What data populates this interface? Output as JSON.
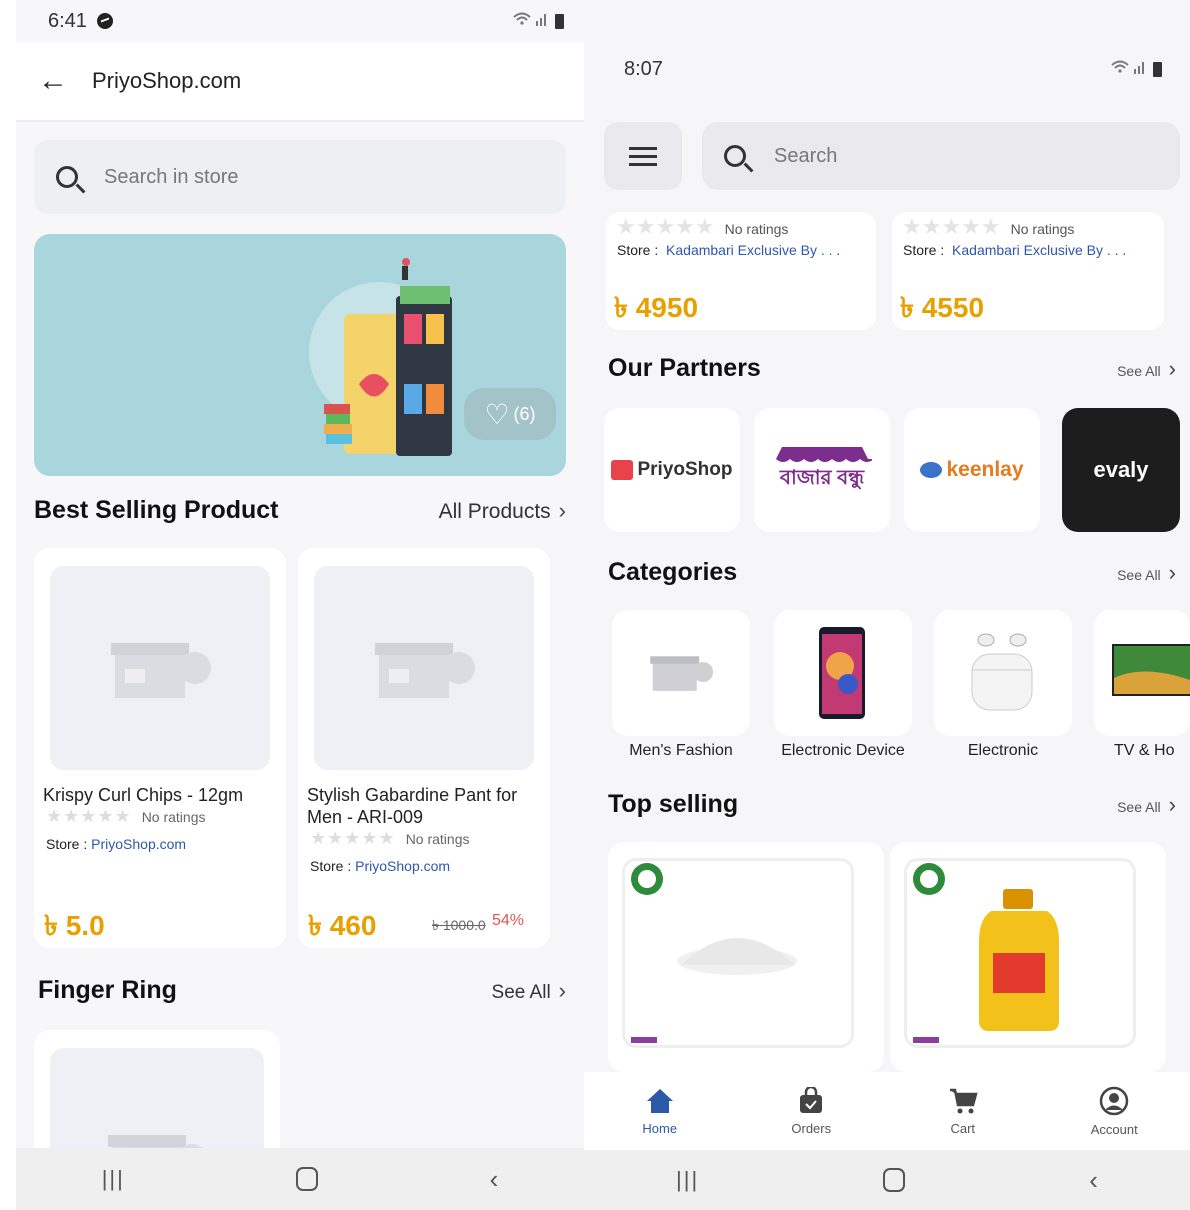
{
  "left": {
    "status": {
      "time": "6:41"
    },
    "header": {
      "title": "PriyoShop.com"
    },
    "search": {
      "placeholder": "Search in store"
    },
    "banner": {
      "fav_count": "(6)"
    },
    "best_selling": {
      "title": "Best Selling Product",
      "link": "All Products",
      "products": [
        {
          "name": "Krispy Curl Chips - 12gm",
          "ratings": "No ratings",
          "store_label": "Store :",
          "store": "PriyoShop.com",
          "price": "৳ 5.0"
        },
        {
          "name": "Stylish Gabardine Pant for Men - ARI-009",
          "ratings": "No ratings",
          "store_label": "Store :",
          "store": "PriyoShop.com",
          "price": "৳ 460",
          "old_price": "৳ 1000.0",
          "discount": "54%"
        }
      ]
    },
    "finger_ring": {
      "title": "Finger Ring",
      "link": "See All"
    }
  },
  "right": {
    "status": {
      "time": "8:07"
    },
    "search": {
      "placeholder": "Search"
    },
    "top_cards": [
      {
        "ratings": "No ratings",
        "store_label": "Store :",
        "store": "Kadambari Exclusive By . . .",
        "price": "৳ 4950"
      },
      {
        "ratings": "No ratings",
        "store_label": "Store :",
        "store": "Kadambari Exclusive By . . .",
        "price": "৳ 4550"
      }
    ],
    "partners": {
      "title": "Our Partners",
      "link": "See All",
      "items": [
        "PriyoShop",
        "বাজার বন্ধু",
        "keenlay",
        "evaly"
      ]
    },
    "categories": {
      "title": "Categories",
      "link": "See All",
      "items": [
        "Men's Fashion",
        "Electronic Device",
        "Electronic",
        "TV & Ho"
      ]
    },
    "top_selling": {
      "title": "Top selling",
      "link": "See All"
    },
    "tabs": [
      "Home",
      "Orders",
      "Cart",
      "Account"
    ],
    "colors": {
      "accent": "#2a5aa8",
      "price": "#e8a000",
      "discount": "#e25555"
    }
  }
}
